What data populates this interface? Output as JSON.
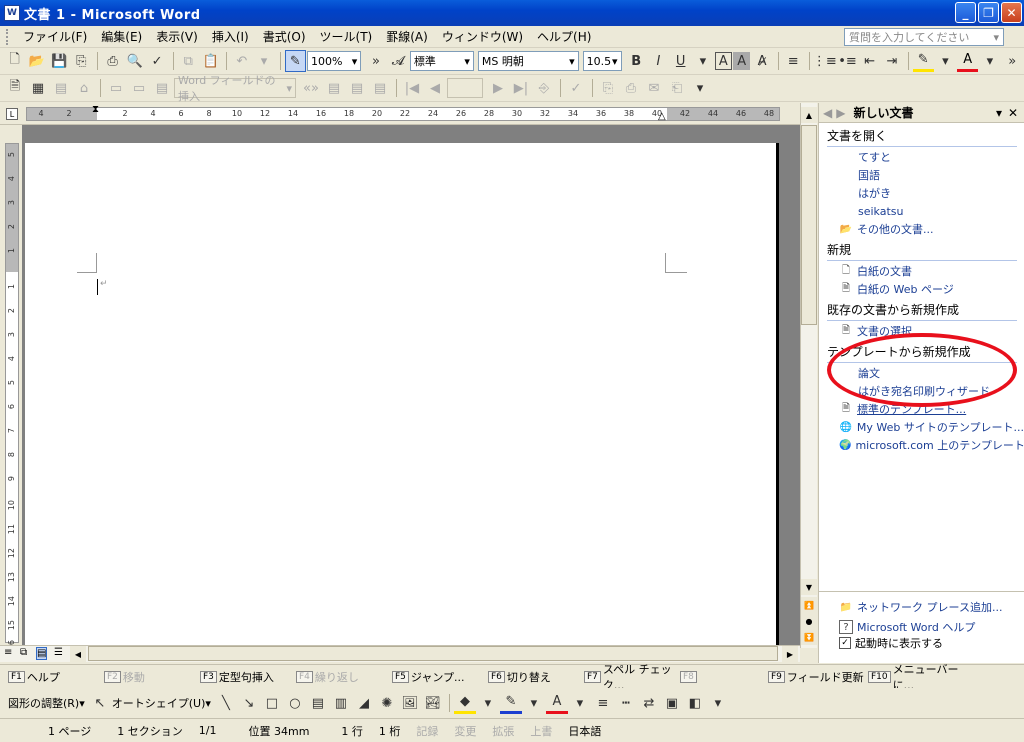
{
  "window": {
    "title": "文書 1 - Microsoft Word",
    "app_icon": "W"
  },
  "menu": [
    "ファイル(F)",
    "編集(E)",
    "表示(V)",
    "挿入(I)",
    "書式(O)",
    "ツール(T)",
    "罫線(A)",
    "ウィンドウ(W)",
    "ヘルプ(H)"
  ],
  "help_box": {
    "placeholder": "質問を入力してください"
  },
  "formatting": {
    "zoom": "100%",
    "style": "標準",
    "font": "MS 明朝",
    "size": "10.5"
  },
  "toolbar2": {
    "word_field": "Word フィールドの挿入"
  },
  "ruler_h": [
    "4",
    "2",
    "2",
    "4",
    "6",
    "8",
    "10",
    "12",
    "14",
    "16",
    "18",
    "20",
    "22",
    "24",
    "26",
    "28",
    "30",
    "32",
    "34",
    "36",
    "38",
    "40",
    "42",
    "44",
    "46",
    "48"
  ],
  "ruler_v": [
    "5",
    "4",
    "3",
    "2",
    "1",
    "1",
    "2",
    "3",
    "4",
    "5",
    "6",
    "7",
    "8",
    "9",
    "10",
    "11",
    "12",
    "13",
    "14",
    "15",
    "16"
  ],
  "taskpane": {
    "title": "新しい文書",
    "open_heading": "文書を開く",
    "recent": [
      "てすと",
      "国語",
      "はがき",
      "seikatsu"
    ],
    "more_docs": "その他の文書...",
    "new_heading": "新規",
    "blank_doc": "白紙の文書",
    "blank_web": "白紙の Web ページ",
    "existing_heading": "既存の文書から新規作成",
    "choose_doc": "文書の選択...",
    "template_heading": "テンプレートから新規作成",
    "templates": [
      "論文",
      "はがき宛名印刷ウィザード",
      "標準のテンプレート...",
      "My Web サイトのテンプレート...",
      "microsoft.com 上のテンプレート"
    ],
    "network_place": "ネットワーク プレース追加...",
    "word_help": "Microsoft Word ヘルプ",
    "show_startup": "起動時に表示する"
  },
  "fkeys": [
    {
      "key": "F1",
      "label": "ヘルプ",
      "enabled": true
    },
    {
      "key": "F2",
      "label": "移動",
      "enabled": false
    },
    {
      "key": "F3",
      "label": "定型句挿入",
      "enabled": true
    },
    {
      "key": "F4",
      "label": "繰り返し",
      "enabled": false
    },
    {
      "key": "F5",
      "label": "ジャンプ...",
      "enabled": true
    },
    {
      "key": "F6",
      "label": "切り替え",
      "enabled": true
    },
    {
      "key": "F7",
      "label": "スペル チェック...",
      "enabled": true
    },
    {
      "key": "F8",
      "label": "",
      "enabled": false
    },
    {
      "key": "F9",
      "label": "フィールド更新",
      "enabled": true
    },
    {
      "key": "F10",
      "label": "メニューバーに...",
      "enabled": true
    }
  ],
  "drawbar": {
    "adjust": "図形の調整(R)",
    "autoshape": "オートシェイプ(U)"
  },
  "status": {
    "page": "1 ページ",
    "section": "1 セクション",
    "pages": "1/1",
    "position": "位置 34mm",
    "line": "1 行",
    "column": "1 桁",
    "rec": "記録",
    "trk": "変更",
    "ext": "拡張",
    "ovr": "上書",
    "lang": "日本語"
  },
  "colors": {
    "highlight_red": "#e8101c",
    "title_blue": "#0a5ddb",
    "link_blue": "#1c3f94"
  }
}
